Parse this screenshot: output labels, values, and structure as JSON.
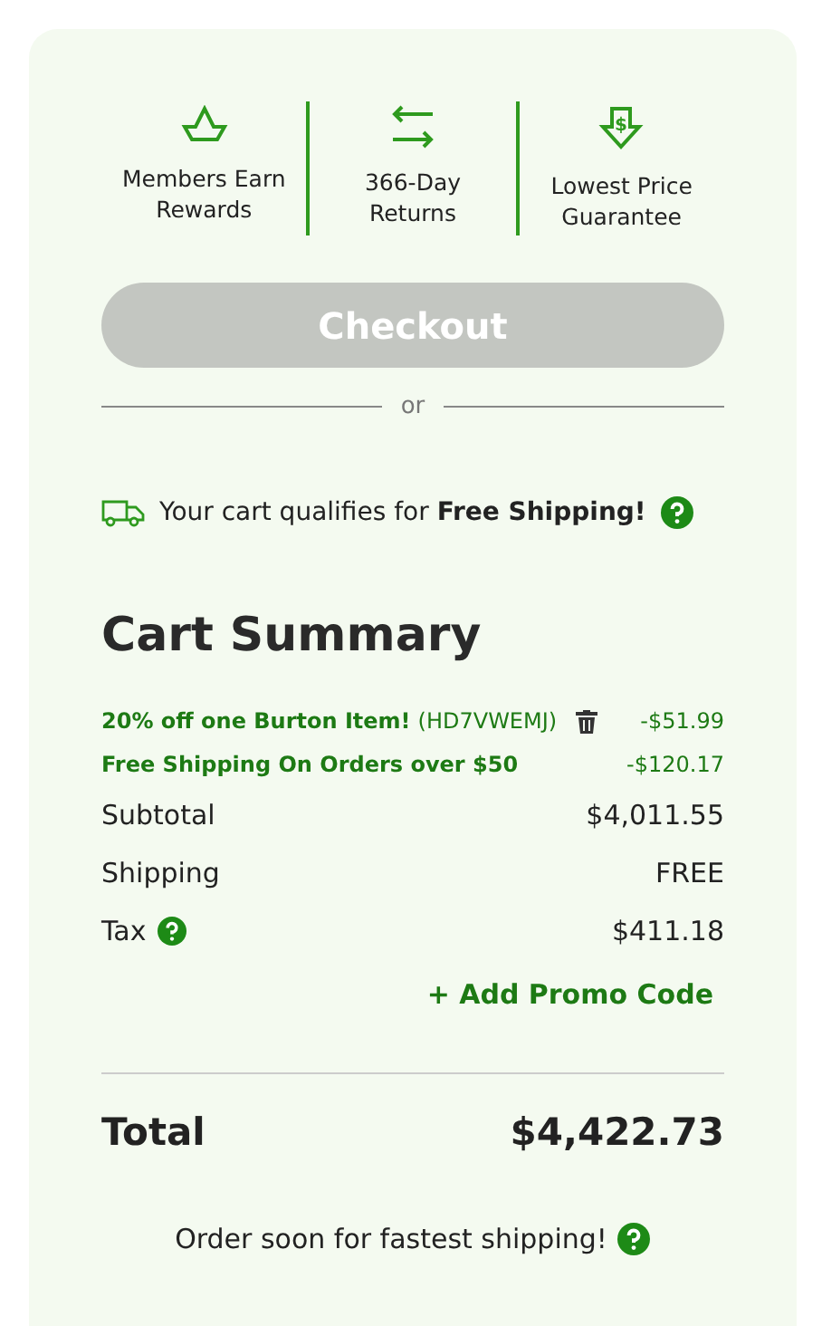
{
  "perks": [
    {
      "kind": "crown",
      "label": "Members Earn Rewards"
    },
    {
      "kind": "arrows",
      "label": "366-Day Returns"
    },
    {
      "kind": "price",
      "symbol": "$",
      "label": "Lowest Price Guarantee"
    }
  ],
  "checkout": {
    "label": "Checkout",
    "disabled": true
  },
  "divider_text": "or",
  "shipping_notice": "Your cart qualifies for **Free Shipping!**",
  "summary": {
    "title": "Cart Summary",
    "discounts": [
      {
        "label": "20% off one Burton Item!",
        "code": "(HD7VWEMJ)",
        "removable": true,
        "amount": "-$51.99"
      },
      {
        "label": "Free Shipping On Orders over $50",
        "removable": false,
        "amount": "-$120.17"
      }
    ],
    "lines": [
      {
        "label": "Subtotal",
        "help": false,
        "value": "$4,011.55"
      },
      {
        "label": "Shipping",
        "help": false,
        "value": "FREE"
      },
      {
        "label": "Tax",
        "help": true,
        "value": "$411.18"
      }
    ],
    "promo_link": "+ Add Promo Code",
    "total_label": "Total",
    "total_value": "$4,422.73",
    "footer_note": "Order soon for fastest shipping!"
  }
}
